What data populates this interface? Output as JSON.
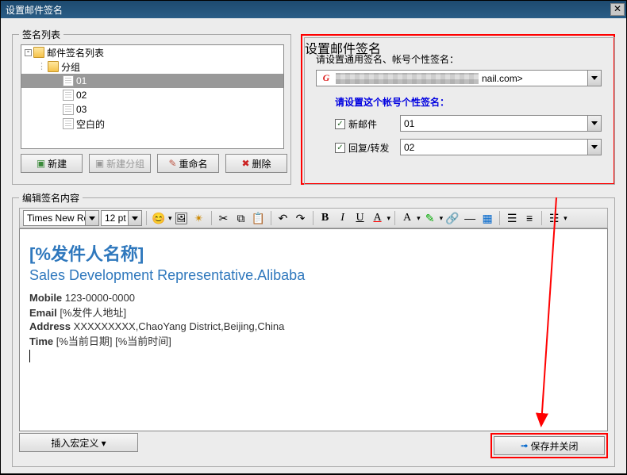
{
  "titlebar": {
    "title": "设置邮件签名"
  },
  "sig_list": {
    "legend": "签名列表",
    "root": "邮件签名列表",
    "group": "分组",
    "items": [
      "01",
      "02",
      "03",
      "空白的"
    ],
    "buttons": {
      "new": "新建",
      "new_group": "新建分组",
      "rename": "重命名",
      "delete": "删除"
    }
  },
  "sig_set": {
    "legend": "设置邮件签名",
    "desc": "请设置通用签名、帐号个性签名：",
    "account_suffix": "nail.com>",
    "desc2": "请设置这个帐号个性签名：",
    "new_mail_label": "新邮件",
    "new_mail_value": "01",
    "reply_label": "回复/转发",
    "reply_value": "02"
  },
  "edit": {
    "legend": "编辑签名内容",
    "font_name": "Times New Ro",
    "font_size": "12 pt",
    "sig": {
      "name": "[%发件人名称]",
      "role": "Sales Development Representative.Alibaba",
      "mobile_l": "Mobile",
      "mobile_v": "123-0000-0000",
      "email_l": "Email",
      "email_v": "[%发件人地址]",
      "addr_l": "Address",
      "addr_v": "XXXXXXXXX,ChaoYang District,Beijing,China",
      "time_l": "Time",
      "time_v": "[%当前日期] [%当前时间]"
    },
    "insert_macro": "插入宏定义 ▾",
    "save_close": "保存并关闭"
  },
  "chart_data": null
}
